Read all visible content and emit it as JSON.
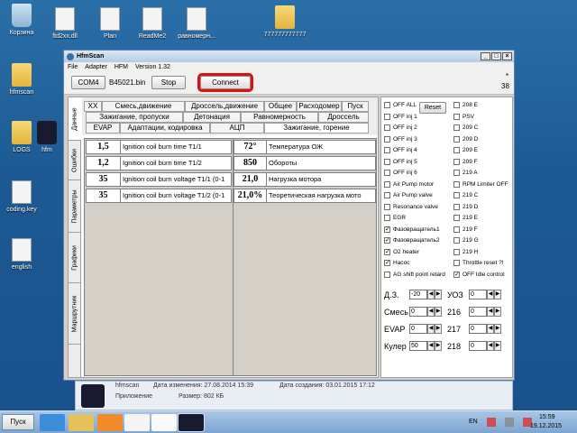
{
  "desktop": {
    "icons": [
      {
        "label": "Корзина",
        "kind": "bin"
      },
      {
        "label": "ftd2xx.dll",
        "kind": "doc"
      },
      {
        "label": "Plan",
        "kind": "doc"
      },
      {
        "label": "ReadMe2",
        "kind": "doc"
      },
      {
        "label": "равномерн...",
        "kind": "doc"
      },
      {
        "label": "777777777777",
        "kind": "folder"
      },
      {
        "label": "hfmscan",
        "kind": "folder"
      },
      {
        "label": "LOGS",
        "kind": "folder"
      },
      {
        "label": "hfm",
        "kind": "app"
      },
      {
        "label": "coding.key",
        "kind": "doc"
      },
      {
        "label": "english",
        "kind": "doc"
      }
    ]
  },
  "window": {
    "title": "HfmScan",
    "menu": [
      "File",
      "Adapter",
      "HFM",
      "Version 1.32"
    ],
    "toolbar": {
      "com_label": "COM4",
      "file_label": "B45021.bin",
      "stop_label": "Stop",
      "connect_label": "Connect",
      "star": "*",
      "counter": "38"
    },
    "vtabs": [
      "Данные",
      "Ошибки",
      "Параметры",
      "Графики",
      "Маршрутник"
    ],
    "htabs": {
      "row1": [
        "XX",
        "Смесь,движение",
        "Дроссель,движение",
        "Общее",
        "Расходомер",
        "Пуск"
      ],
      "row2": [
        "Зажигание, пропуски",
        "Детонация",
        "Равномерность",
        "Дроссель"
      ],
      "row3": [
        "EVAP",
        "Адаптации, кодировка",
        "АЦП",
        "Зажигание, горение"
      ]
    },
    "grid_left": [
      {
        "value": "1,5",
        "name": "Ignition coil burn time T1/1"
      },
      {
        "value": "1,2",
        "name": "Ignition coil burn time T1/2"
      },
      {
        "value": "35",
        "name": "Ignition coil burn voltage T1/1 (0-1"
      },
      {
        "value": "35",
        "name": "Ignition coil burn voltage T1/2 (0-1"
      }
    ],
    "grid_right": [
      {
        "value": "72°",
        "name": "Температура ОЖ"
      },
      {
        "value": "850",
        "name": "Обороты"
      },
      {
        "value": "21,0",
        "name": "Нагрузка мотора"
      },
      {
        "value": "21,0%",
        "name": "Теоретическая нагрузка мото"
      }
    ],
    "checks_left": [
      {
        "label": "OFF ALL",
        "checked": false
      },
      {
        "label": "OFF inj 1",
        "checked": false
      },
      {
        "label": "OFF inj 2",
        "checked": false
      },
      {
        "label": "OFF inj 3",
        "checked": false
      },
      {
        "label": "OFF inj 4",
        "checked": false
      },
      {
        "label": "OFF inj 5",
        "checked": false
      },
      {
        "label": "OFF inj 6",
        "checked": false
      },
      {
        "label": "Air Pump motor",
        "checked": false
      },
      {
        "label": "Air Pump valve",
        "checked": false
      },
      {
        "label": "Resonance valve",
        "checked": false
      },
      {
        "label": "EGR",
        "checked": false
      },
      {
        "label": "Фазовращатель1",
        "checked": true
      },
      {
        "label": "Фазовращатель2",
        "checked": true
      },
      {
        "label": "O2 heater",
        "checked": true
      },
      {
        "label": "Насос",
        "checked": true
      },
      {
        "label": "AG shift point retard",
        "checked": false
      }
    ],
    "reset_label": "Reset",
    "checks_right": [
      {
        "label": "208 E",
        "checked": false
      },
      {
        "label": "PSV",
        "checked": false
      },
      {
        "label": "209 C",
        "checked": false
      },
      {
        "label": "209 D",
        "checked": false
      },
      {
        "label": "209 E",
        "checked": false
      },
      {
        "label": "209 F",
        "checked": false
      },
      {
        "label": "219 A",
        "checked": false
      },
      {
        "label": "RPM Limiter OFF",
        "checked": false
      },
      {
        "label": "219 C",
        "checked": false
      },
      {
        "label": "219 D",
        "checked": false
      },
      {
        "label": "219 E",
        "checked": false
      },
      {
        "label": "219 F",
        "checked": false
      },
      {
        "label": "219 G",
        "checked": false
      },
      {
        "label": "219 H",
        "checked": false
      },
      {
        "label": "Throttle reset ?!",
        "checked": false
      },
      {
        "label": "OFF Idle control",
        "checked": true
      }
    ],
    "controls": [
      {
        "label": "Д.З.",
        "value": "-20",
        "label2": "УОЗ",
        "value2": "0"
      },
      {
        "label": "Смесь",
        "value": "0",
        "label2": "216",
        "value2": "0"
      },
      {
        "label": "EVAP",
        "value": "0",
        "label2": "217",
        "value2": "0"
      },
      {
        "label": "Кулер",
        "value": "50",
        "label2": "218",
        "value2": "0"
      }
    ]
  },
  "details": {
    "name": "hfmscan",
    "modified": "Дата изменения: 27.08.2014 15:39",
    "created": "Дата создания: 03.01.2015 17:12",
    "type": "Приложение",
    "size": "Размер: 802 КБ"
  },
  "taskbar": {
    "start_label": "Пуск",
    "lang": "EN",
    "time": "15:59",
    "date": "19.12.2015"
  }
}
